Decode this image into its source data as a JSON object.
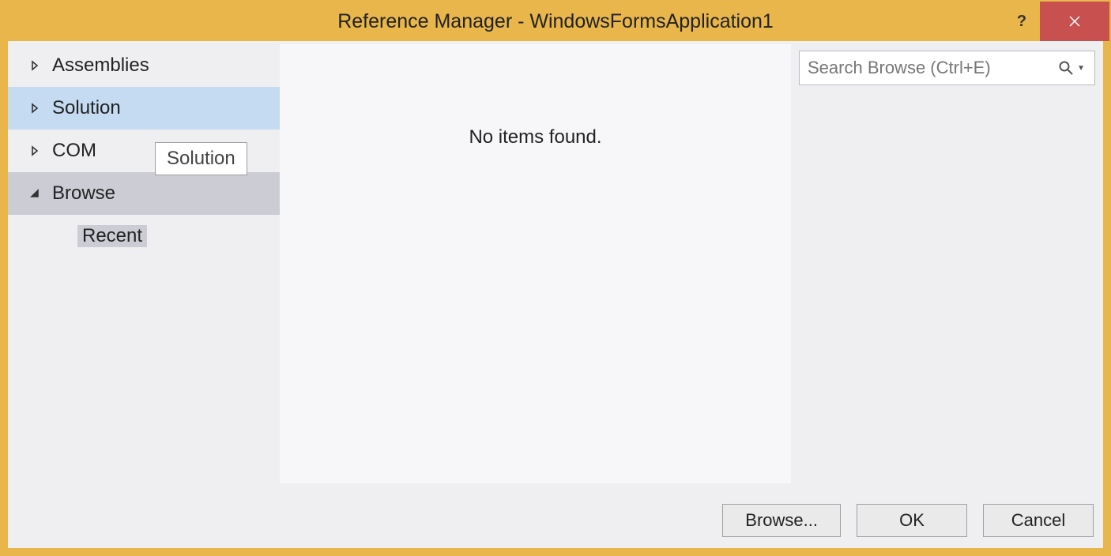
{
  "window": {
    "title": "Reference Manager - WindowsFormsApplication1"
  },
  "sidebar": {
    "items": [
      {
        "label": "Assemblies",
        "expanded": false
      },
      {
        "label": "Solution",
        "expanded": false
      },
      {
        "label": "COM",
        "expanded": false
      },
      {
        "label": "Browse",
        "expanded": true
      }
    ],
    "subitems": [
      {
        "label": "Recent"
      }
    ]
  },
  "tooltip": {
    "text": "Solution"
  },
  "main": {
    "empty_message": "No items found."
  },
  "search": {
    "placeholder": "Search Browse (Ctrl+E)"
  },
  "footer": {
    "browse_label": "Browse...",
    "ok_label": "OK",
    "cancel_label": "Cancel"
  }
}
